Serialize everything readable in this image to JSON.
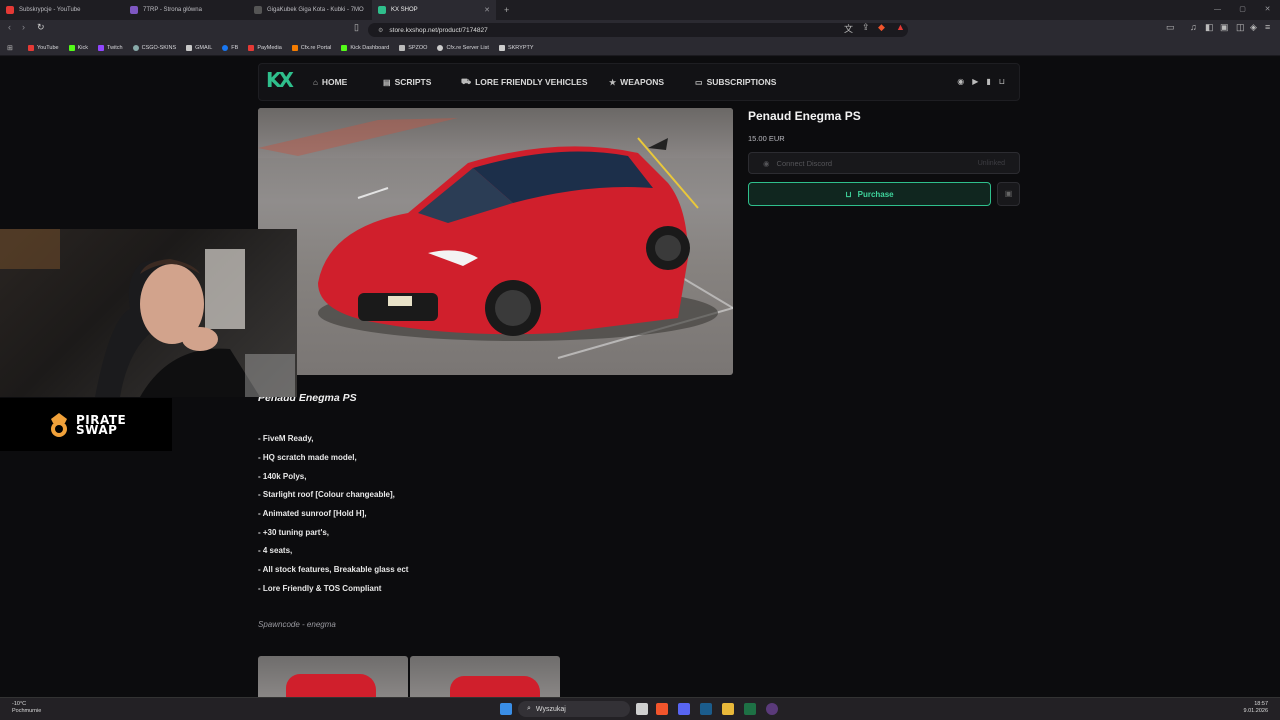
{
  "browser": {
    "tabs": [
      {
        "label": "Subskrypcje - YouTube",
        "color": "#e53935"
      },
      {
        "label": "7TRP - Strona główna",
        "color": "#7e57c2"
      },
      {
        "label": "GigaKubek Giga Kota - Kubki - 7MO",
        "color": "#444"
      },
      {
        "label": "KX SHOP",
        "color": "#2fbf8c"
      }
    ],
    "url": "store.kxshop.net/product/7174827",
    "bookmarks": [
      {
        "label": "YouTube",
        "color": "#e53935"
      },
      {
        "label": "Kick",
        "color": "#53fc18"
      },
      {
        "label": "Twitch",
        "color": "#9146ff"
      },
      {
        "label": "CSGO-SKINS",
        "color": "#8aa"
      },
      {
        "label": "GMAIL",
        "color": "#c8c8c8"
      },
      {
        "label": "FB",
        "color": "#1877f2"
      },
      {
        "label": "PayMedia",
        "color": "#e53935"
      },
      {
        "label": "Cfx.re Portal",
        "color": "#f57c00"
      },
      {
        "label": "Kick Dashboard",
        "color": "#53fc18"
      },
      {
        "label": "SPZOO",
        "color": "#bbb"
      },
      {
        "label": "Cfx.re Server List",
        "color": "#ccc"
      },
      {
        "label": "SKRYPTY",
        "color": "#ccc"
      }
    ]
  },
  "site": {
    "logo": "KX",
    "nav": [
      {
        "label": "HOME",
        "icon": "⌂"
      },
      {
        "label": "SCRIPTS",
        "icon": "▤"
      },
      {
        "label": "LORE FRIENDLY VEHICLES",
        "icon": "⛟"
      },
      {
        "label": "WEAPONS",
        "icon": "★"
      },
      {
        "label": "SUBSCRIPTIONS",
        "icon": "▭"
      }
    ],
    "nav_right_icons": [
      "discord-icon",
      "youtube-icon",
      "book-icon",
      "cart-icon"
    ]
  },
  "product": {
    "title": "Penaud Enegma PS",
    "price": "15.00 EUR",
    "connect_discord": "Connect Discord",
    "discord_status": "Unlinked",
    "purchase": "Purchase",
    "accent": "#2fbf8c"
  },
  "description": {
    "title": "Penaud Enegma PS",
    "features": [
      "- FiveM Ready,",
      "- HQ scratch made model,",
      "- 140k Polys,",
      "- Starlight roof [Colour changeable],",
      "- Animated sunroof [Hold H],",
      "- +30 tuning part's,",
      "- 4 seats,",
      "- All stock features, Breakable glass ect",
      "- Lore Friendly & TOS Compliant"
    ],
    "spawncode": "Spawncode - enegma"
  },
  "overlay": {
    "sponsor_line1": "PIRATE",
    "sponsor_line2": "SWAP"
  },
  "taskbar": {
    "weather_temp": "-10°C",
    "weather_desc": "Pochmurnie",
    "search": "Wyszukaj",
    "time": "18:57",
    "date": "9.01.2026"
  }
}
